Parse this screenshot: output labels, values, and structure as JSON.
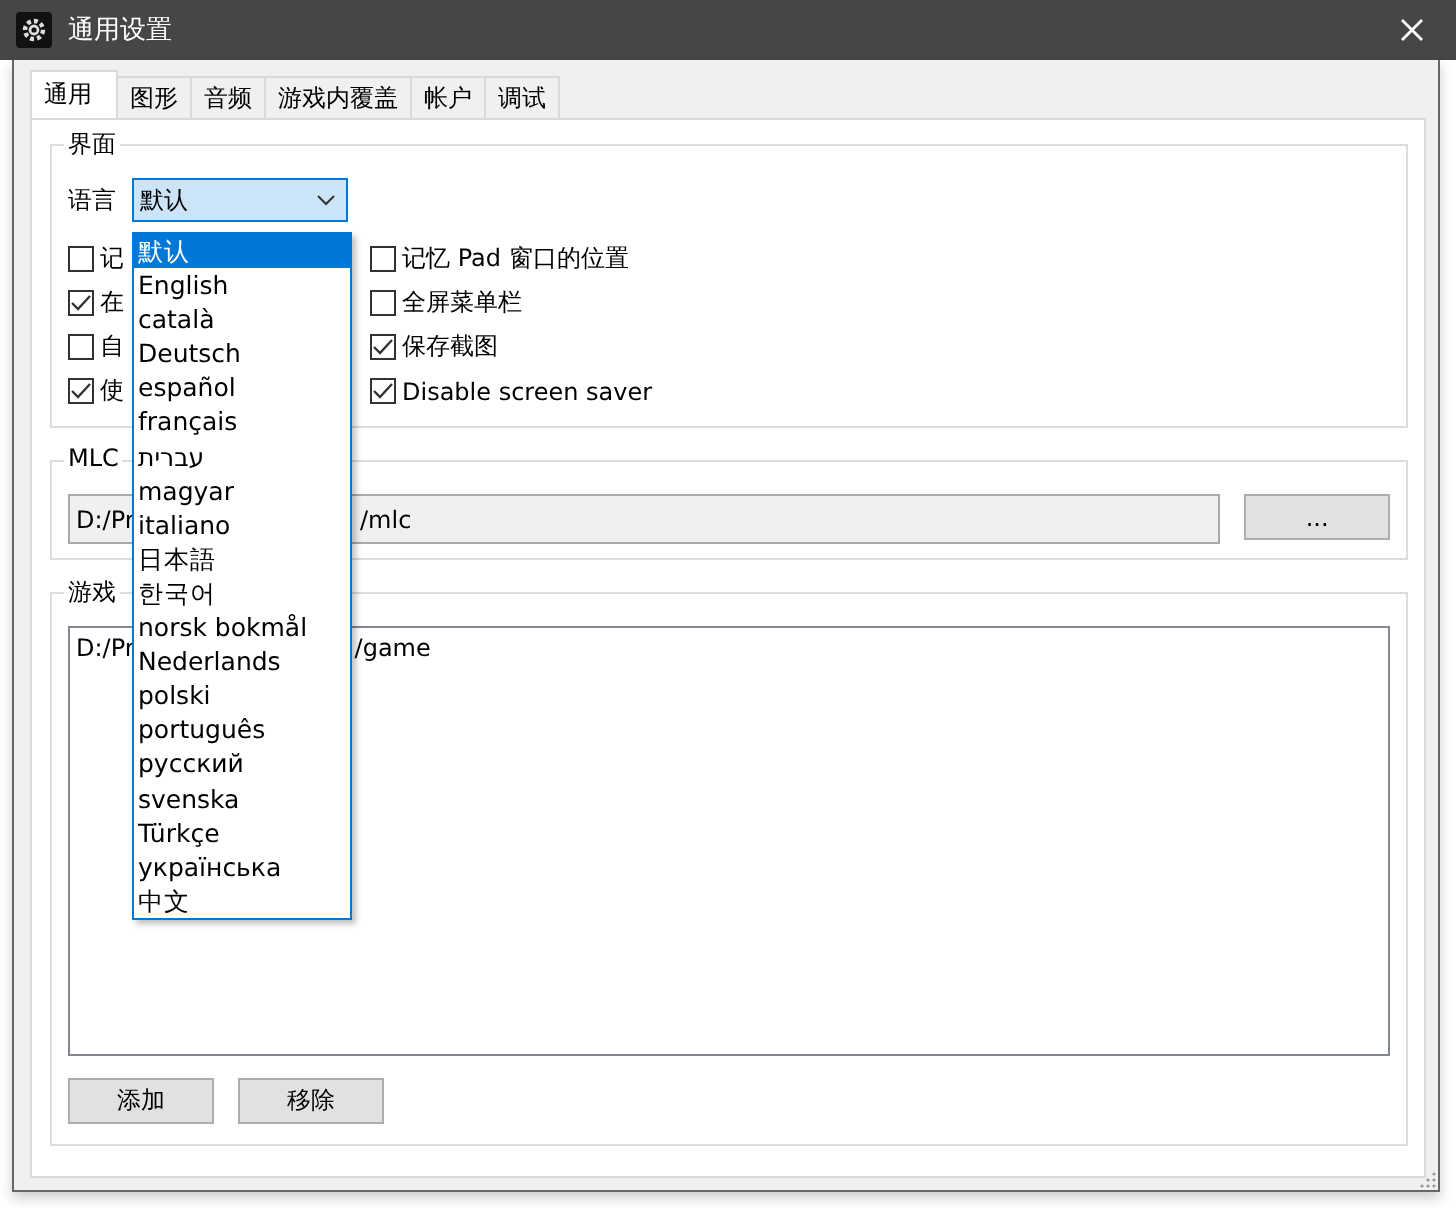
{
  "window": {
    "title": "通用设置"
  },
  "tabs": [
    {
      "label": "通用",
      "selected": true
    },
    {
      "label": "图形",
      "selected": false
    },
    {
      "label": "音频",
      "selected": false
    },
    {
      "label": "游戏内覆盖",
      "selected": false
    },
    {
      "label": "帐户",
      "selected": false
    },
    {
      "label": "调试",
      "selected": false
    }
  ],
  "interface_group": {
    "title": "界面",
    "language_label": "语言",
    "language_value": "默认",
    "checkboxes_left": [
      {
        "label": "记",
        "checked": false
      },
      {
        "label": "在",
        "checked": true
      },
      {
        "label": "自",
        "checked": false
      },
      {
        "label": "使",
        "checked": true
      }
    ],
    "checkboxes_right": [
      {
        "label": "记忆 Pad 窗口的位置",
        "checked": false
      },
      {
        "label": "全屏菜单栏",
        "checked": false
      },
      {
        "label": "保存截图",
        "checked": true
      },
      {
        "label": "Disable screen saver",
        "checked": true
      }
    ]
  },
  "mlc_group": {
    "title": "MLC",
    "path_start": "D:/Pr",
    "path_end": "/mlc",
    "browse_button": "..."
  },
  "game_group": {
    "title": "游戏",
    "paths": [
      {
        "start": "D:/Pr",
        "end": "/game"
      }
    ],
    "buttons": [
      "添加",
      "移除"
    ]
  },
  "language_dropdown": [
    {
      "label": "默认",
      "selected": true
    },
    {
      "label": "English",
      "selected": false
    },
    {
      "label": "català",
      "selected": false
    },
    {
      "label": "Deutsch",
      "selected": false
    },
    {
      "label": "español",
      "selected": false
    },
    {
      "label": "français",
      "selected": false
    },
    {
      "label": "עברית",
      "selected": false
    },
    {
      "label": "magyar",
      "selected": false
    },
    {
      "label": "italiano",
      "selected": false
    },
    {
      "label": "日本語",
      "selected": false
    },
    {
      "label": "한국어",
      "selected": false
    },
    {
      "label": "norsk bokmål",
      "selected": false
    },
    {
      "label": "Nederlands",
      "selected": false
    },
    {
      "label": "polski",
      "selected": false
    },
    {
      "label": "português",
      "selected": false
    },
    {
      "label": "русский",
      "selected": false
    },
    {
      "label": "svenska",
      "selected": false
    },
    {
      "label": "Türkçe",
      "selected": false
    },
    {
      "label": "українська",
      "selected": false
    },
    {
      "label": "中文",
      "selected": false
    }
  ]
}
